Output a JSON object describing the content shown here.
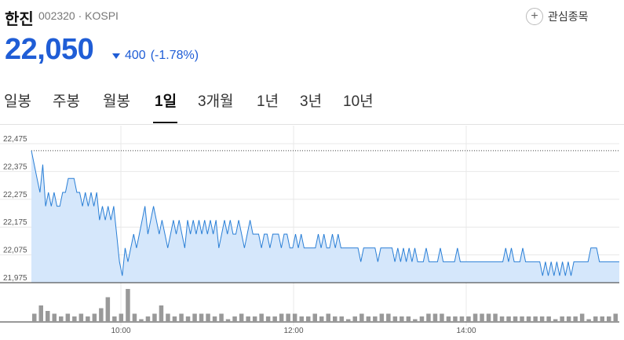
{
  "stock": {
    "name": "한진",
    "code_market": "002320 · KOSPI",
    "price": "22,050",
    "change": "400",
    "change_pct": "(-1.78%)",
    "watch_label": "관심종목"
  },
  "tabs": [
    "일봉",
    "주봉",
    "월봉",
    "1일",
    "3개월",
    "1년",
    "3년",
    "10년"
  ],
  "active_tab": "1일",
  "colors": {
    "price_down": "#1f5dd6",
    "line": "#2a7fd6",
    "area": "#d5e7fb",
    "volume_bar": "#999999",
    "volume_bar_highlight": "#888888"
  },
  "chart_data": {
    "type": "area",
    "title": "",
    "xlabel": "",
    "ylabel": "",
    "ylim": [
      21975,
      22475
    ],
    "yticks": [
      "22,475",
      "22,375",
      "22,275",
      "22,175",
      "22,075",
      "21,975"
    ],
    "xticks": [
      "10:00",
      "12:00",
      "14:00"
    ],
    "previous_close": 22450,
    "series": [
      {
        "values": [
          22450,
          22400,
          22350,
          22300,
          22400,
          22250,
          22300,
          22250,
          22300,
          22250,
          22250,
          22300,
          22300,
          22350,
          22350,
          22350,
          22300,
          22300,
          22250,
          22300,
          22250,
          22300,
          22250,
          22300,
          22200,
          22250,
          22200,
          22250,
          22200,
          22250,
          22150,
          22050,
          22000,
          22100,
          22050,
          22100,
          22150,
          22100,
          22150,
          22200,
          22250,
          22150,
          22200,
          22250,
          22200,
          22150,
          22200,
          22150,
          22100,
          22150,
          22200,
          22150,
          22200,
          22150,
          22100,
          22200,
          22150,
          22200,
          22150,
          22200,
          22150,
          22200,
          22150,
          22200,
          22150,
          22200,
          22100,
          22150,
          22200,
          22150,
          22200,
          22150,
          22150,
          22200,
          22150,
          22100,
          22150,
          22200,
          22150,
          22150,
          22150,
          22100,
          22150,
          22150,
          22100,
          22150,
          22150,
          22150,
          22100,
          22150,
          22150,
          22100,
          22100,
          22150,
          22100,
          22150,
          22100,
          22100,
          22100,
          22100,
          22100,
          22150,
          22100,
          22150,
          22100,
          22100,
          22150,
          22100,
          22150,
          22100,
          22100,
          22100,
          22100,
          22100,
          22100,
          22100,
          22050,
          22100,
          22100,
          22100,
          22100,
          22100,
          22050,
          22100,
          22100,
          22100,
          22100,
          22100,
          22050,
          22100,
          22050,
          22100,
          22050,
          22100,
          22050,
          22100,
          22050,
          22050,
          22050,
          22100,
          22050,
          22050,
          22050,
          22050,
          22100,
          22050,
          22050,
          22050,
          22050,
          22050,
          22100,
          22050,
          22050,
          22050,
          22050,
          22050,
          22050,
          22050,
          22050,
          22050,
          22050,
          22050,
          22050,
          22050,
          22050,
          22050,
          22050,
          22100,
          22050,
          22100,
          22050,
          22050,
          22050,
          22100,
          22050,
          22050,
          22050,
          22050,
          22050,
          22050,
          22000,
          22050,
          22000,
          22050,
          22000,
          22050,
          22000,
          22050,
          22000,
          22050,
          22000,
          22050,
          22050,
          22050,
          22050,
          22050,
          22050,
          22100,
          22100,
          22100,
          22050,
          22050,
          22050,
          22050,
          22050,
          22050,
          22050,
          22050
        ]
      }
    ],
    "volume": [
      3,
      6,
      4,
      3,
      2,
      3,
      2,
      3,
      2,
      3,
      5,
      9,
      2,
      3,
      12,
      3,
      1,
      2,
      3,
      6,
      3,
      2,
      3,
      2,
      3,
      3,
      3,
      2,
      3,
      1,
      2,
      3,
      2,
      2,
      3,
      2,
      2,
      3,
      3,
      3,
      2,
      2,
      3,
      2,
      3,
      2,
      2,
      1,
      2,
      3,
      2,
      2,
      3,
      3,
      2,
      2,
      2,
      1,
      2,
      3,
      3,
      3,
      2,
      2,
      2,
      2,
      3,
      3,
      3,
      3,
      2,
      2,
      2,
      2,
      2,
      2,
      2,
      2,
      1,
      2,
      2,
      2,
      3,
      1,
      2,
      2,
      2,
      3
    ]
  }
}
